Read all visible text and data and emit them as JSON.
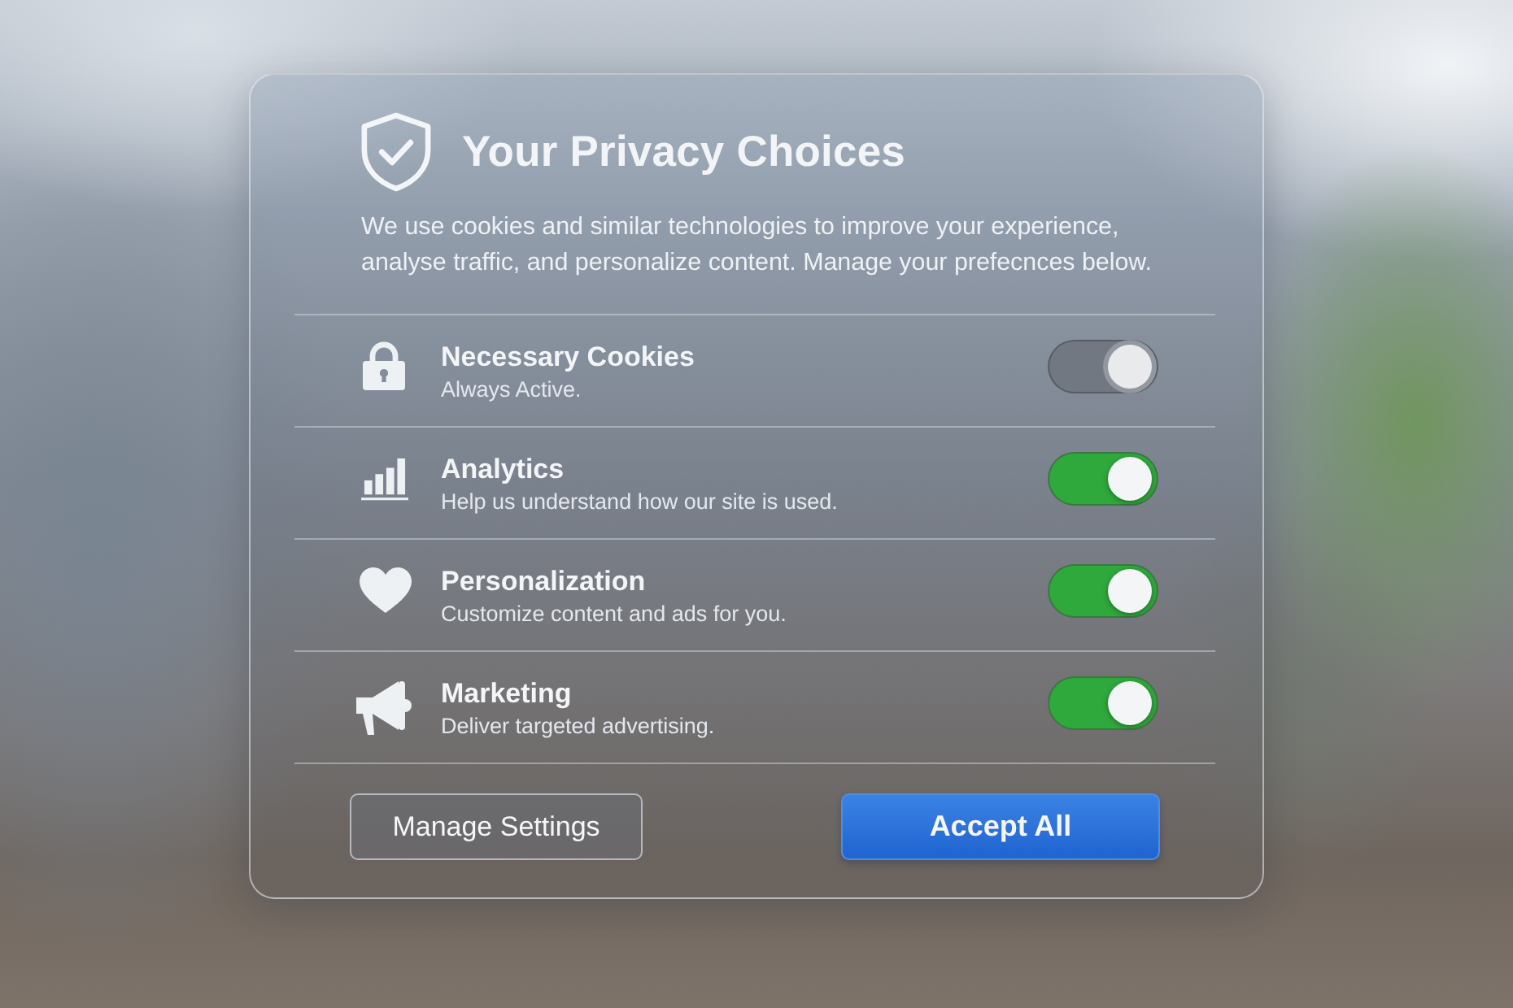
{
  "dialog": {
    "title": "Your Privacy Choices",
    "description": "We use cookies and similar technologies to improve your experience, analyse traffic, and personalize content. Manage your prefecnces below."
  },
  "categories": [
    {
      "kind": "lock",
      "title": "Necessary Cookies",
      "description": "Always Active.",
      "on": true,
      "disabled": true
    },
    {
      "kind": "chart",
      "title": "Analytics",
      "description": "Help us understand how our site is used.",
      "on": true,
      "disabled": false
    },
    {
      "kind": "heart",
      "title": "Personalization",
      "description": "Customize content and ads for you.",
      "on": true,
      "disabled": false
    },
    {
      "kind": "megaphone",
      "title": "Marketing",
      "description": "Deliver targeted advertising.",
      "on": true,
      "disabled": false
    }
  ],
  "buttons": [
    {
      "kind": "secondary",
      "label": "Manage Settings"
    },
    {
      "kind": "primary",
      "label": "Accept All"
    }
  ]
}
